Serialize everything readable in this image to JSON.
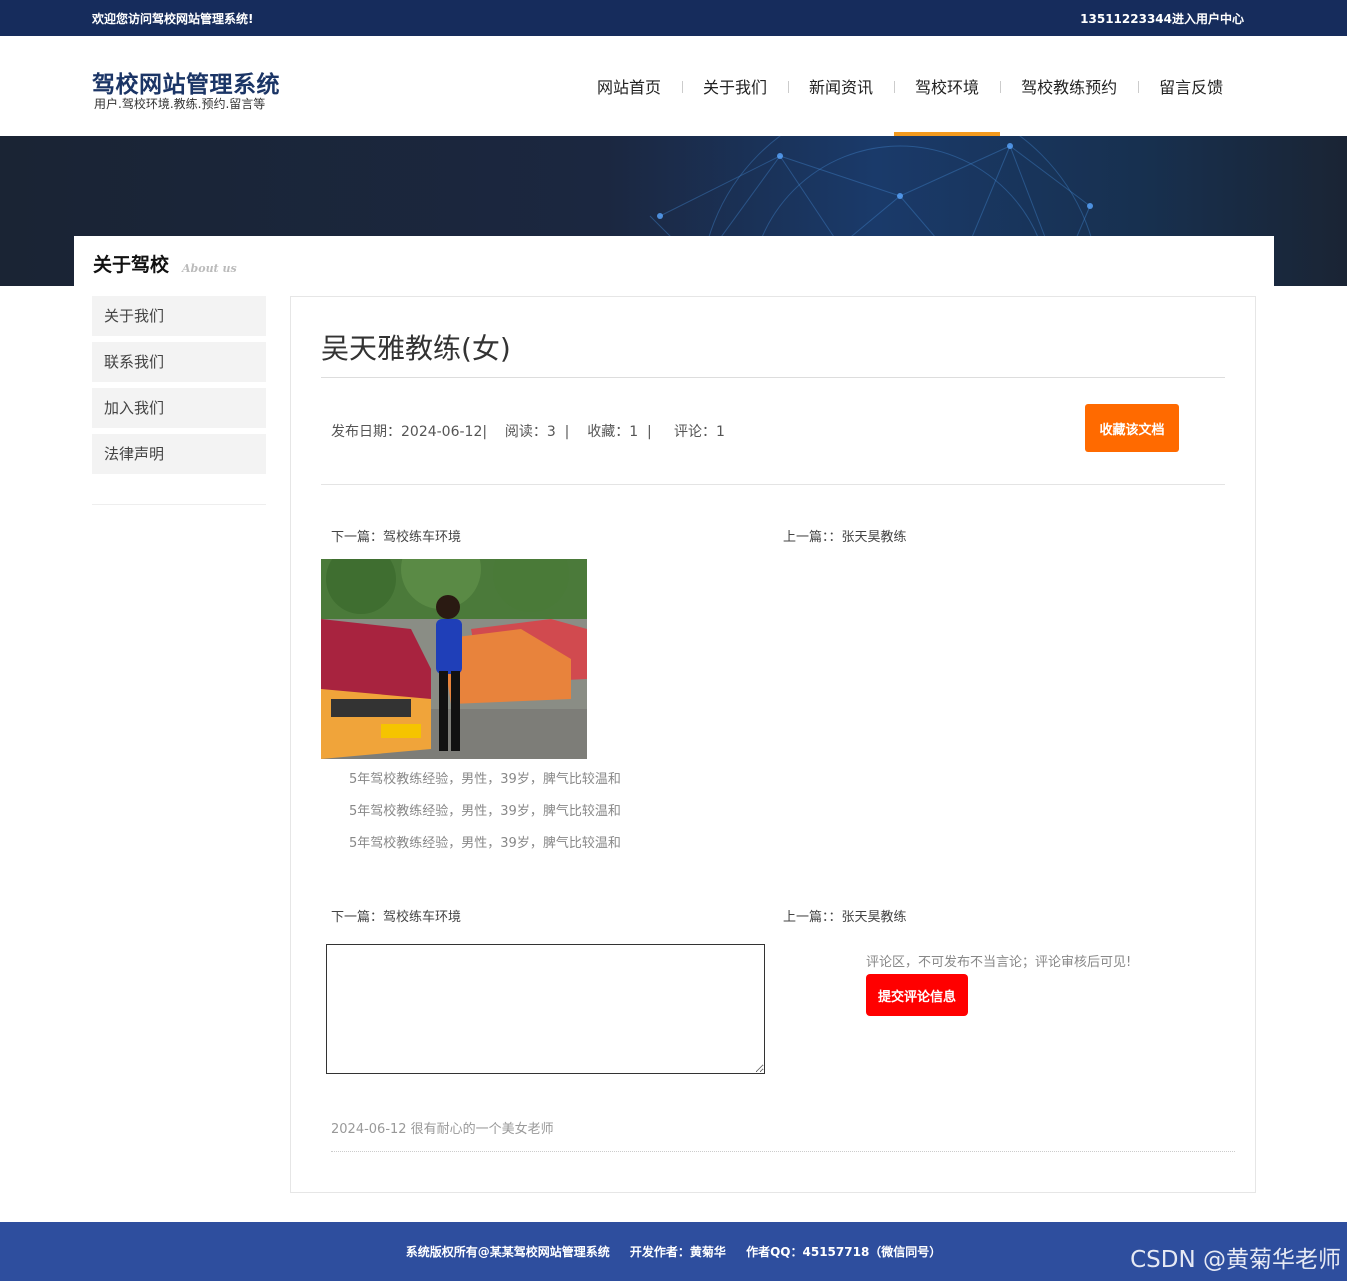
{
  "topbar": {
    "welcome": "欢迎您访问驾校网站管理系统!",
    "user_center": "13511223344进入用户中心"
  },
  "header": {
    "title": "驾校网站管理系统",
    "subtitle": "用户.驾校环境.教练.预约.留言等"
  },
  "nav": [
    {
      "label": "网站首页"
    },
    {
      "label": "关于我们"
    },
    {
      "label": "新闻资讯"
    },
    {
      "label": "驾校环境",
      "active": true
    },
    {
      "label": "驾校教练预约"
    },
    {
      "label": "留言反馈"
    }
  ],
  "section": {
    "title": "关于驾校",
    "subtitle": "About us"
  },
  "sidebar": {
    "items": [
      {
        "label": "关于我们"
      },
      {
        "label": "联系我们"
      },
      {
        "label": "加入我们"
      },
      {
        "label": "法律声明"
      }
    ]
  },
  "article": {
    "title": "吴天雅教练(女)",
    "meta": "发布日期：2024-06-12|    阅读：3  |    收藏：1  |     评论：1",
    "favorite_button": "收藏该文档",
    "next": "下一篇：驾校练车环境",
    "prev": "上一篇：：张天昊教练",
    "description": [
      "5年驾校教练经验，男性，39岁，脾气比较温和",
      "5年驾校教练经验，男性，39岁，脾气比较温和",
      "5年驾校教练经验，男性，39岁，脾气比较温和"
    ]
  },
  "comments": {
    "tip": "评论区，不可发布不当言论；评论审核后可见!",
    "submit_button": "提交评论信息",
    "list": [
      {
        "text": "2024-06-12 很有耐心的一个美女老师"
      }
    ]
  },
  "footer": {
    "copyright": "系统版权所有@某某驾校网站管理系统",
    "developer": "开发作者：黄菊华",
    "qq": "作者QQ：45157718（微信同号）"
  },
  "watermark": "CSDN @黄菊华老师",
  "colors": {
    "topbar": "#162c5c",
    "footer": "#2e4e9e",
    "nav_active": "#f39a1e",
    "favorite": "#ff6a00",
    "submit": "#ff0000"
  }
}
